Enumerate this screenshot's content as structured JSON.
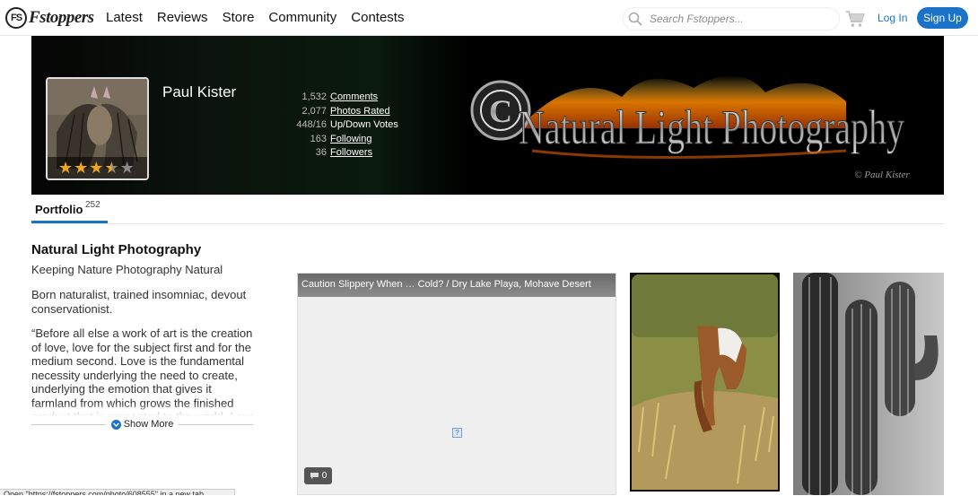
{
  "nav": {
    "logo_text": "Fstoppers",
    "logo_mark": "FS",
    "links": [
      "Latest",
      "Reviews",
      "Store",
      "Community",
      "Contests"
    ],
    "search_placeholder": "Search Fstoppers...",
    "login": "Log In",
    "signup": "Sign Up",
    "accent_color": "#1a73c8"
  },
  "profile": {
    "name": "Paul Kister",
    "rating_stars": 3.5,
    "rating_max": 5,
    "stats": [
      {
        "num": "1,532",
        "label": "Comments",
        "link": true
      },
      {
        "num": "2,077",
        "label": "Photos Rated",
        "link": true
      },
      {
        "num": "448/16",
        "label": "Up/Down Votes",
        "link": false
      },
      {
        "num": "163",
        "label": "Following",
        "link": true
      },
      {
        "num": "36",
        "label": "Followers",
        "link": true
      }
    ],
    "banner_title": "Natural Light Photography",
    "banner_signature": "© Paul Kister"
  },
  "tabs": {
    "portfolio_label": "Portfolio",
    "portfolio_count": "252"
  },
  "bio": {
    "title": "Natural Light Photography",
    "subtitle": "Keeping Nature Photography Natural",
    "para1": "Born naturalist, trained insomniac, devout conservationist.",
    "para2": "“Before all else a work of art is the creation of love, love for the subject first and for the medium second. Love is the fundamental necessity underlying the need to create, underlying the emotion that gives it farmland from which grows the finished product that is presented to the world. Love is the",
    "show_more": "Show More"
  },
  "gallery": {
    "photo1_caption": "Caution Slippery When … Cold? / Dry Lake Playa, Mohave Desert",
    "photo1_comments": "0"
  },
  "status_bar": "Open \"https://fstoppers.com/photo/608555\" in a new tab"
}
